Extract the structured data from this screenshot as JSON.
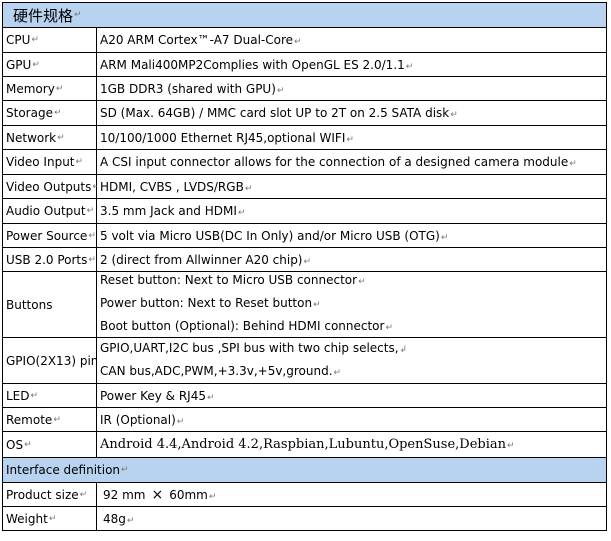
{
  "title": "硬件规格",
  "rows": [
    {
      "label": "CPU",
      "value": "A20 ARM Cortex™-A7 Dual-Core"
    },
    {
      "label": "GPU",
      "value": "ARM Mali400MP2Complies with OpenGL ES 2.0/1.1"
    },
    {
      "label": "Memory",
      "value": "1GB DDR3 (shared with GPU)"
    },
    {
      "label": "Storage",
      "value": "SD (Max. 64GB) / MMC card slot UP to 2T on 2.5 SATA disk"
    },
    {
      "label": "Network",
      "value": "10/100/1000 Ethernet RJ45,optional WIFI"
    },
    {
      "label": "Video Input",
      "value": "A CSI input connector allows for the connection of a designed camera module"
    },
    {
      "label": "Video Outputs",
      "value": "HDMI, CVBS , LVDS/RGB"
    },
    {
      "label": "Audio Output",
      "value": "3.5 mm Jack and HDMI"
    },
    {
      "label": "Power Source",
      "value": "5 volt via Micro USB(DC In Only) and/or Micro USB (OTG)"
    },
    {
      "label": "USB 2.0 Ports",
      "value": "2 (direct from Allwinner A20 chip)"
    }
  ],
  "buttons": {
    "label": "Buttons",
    "lines": [
      "Reset button: Next to Micro USB connector",
      "Power button: Next to Reset button",
      "Boot button (Optional): Behind HDMI connector"
    ]
  },
  "gpio": {
    "label": "GPIO(2X13) pin",
    "lines": [
      "GPIO,UART,I2C bus ,SPI bus with two chip selects,",
      "CAN bus,ADC,PWM,+3.3v,+5v,ground."
    ]
  },
  "led": {
    "label": "LED",
    "value": "Power Key & RJ45"
  },
  "remote": {
    "label": "Remote",
    "value": "IR (Optional)"
  },
  "os": {
    "label": "OS",
    "value": "Android 4.4,Android 4.2,Raspbian,Lubuntu,OpenSuse,Debian"
  },
  "interface_title": "Interface definition",
  "product_size": {
    "label": "Product size",
    "width": "92 mm",
    "times": "×",
    "height": "60mm"
  },
  "weight": {
    "label": "Weight",
    "value": "48g"
  },
  "marks": {
    "para": "↵",
    "enter": "↲"
  },
  "colors": {
    "header_bg": "#b7d3ef",
    "border": "#000000"
  }
}
